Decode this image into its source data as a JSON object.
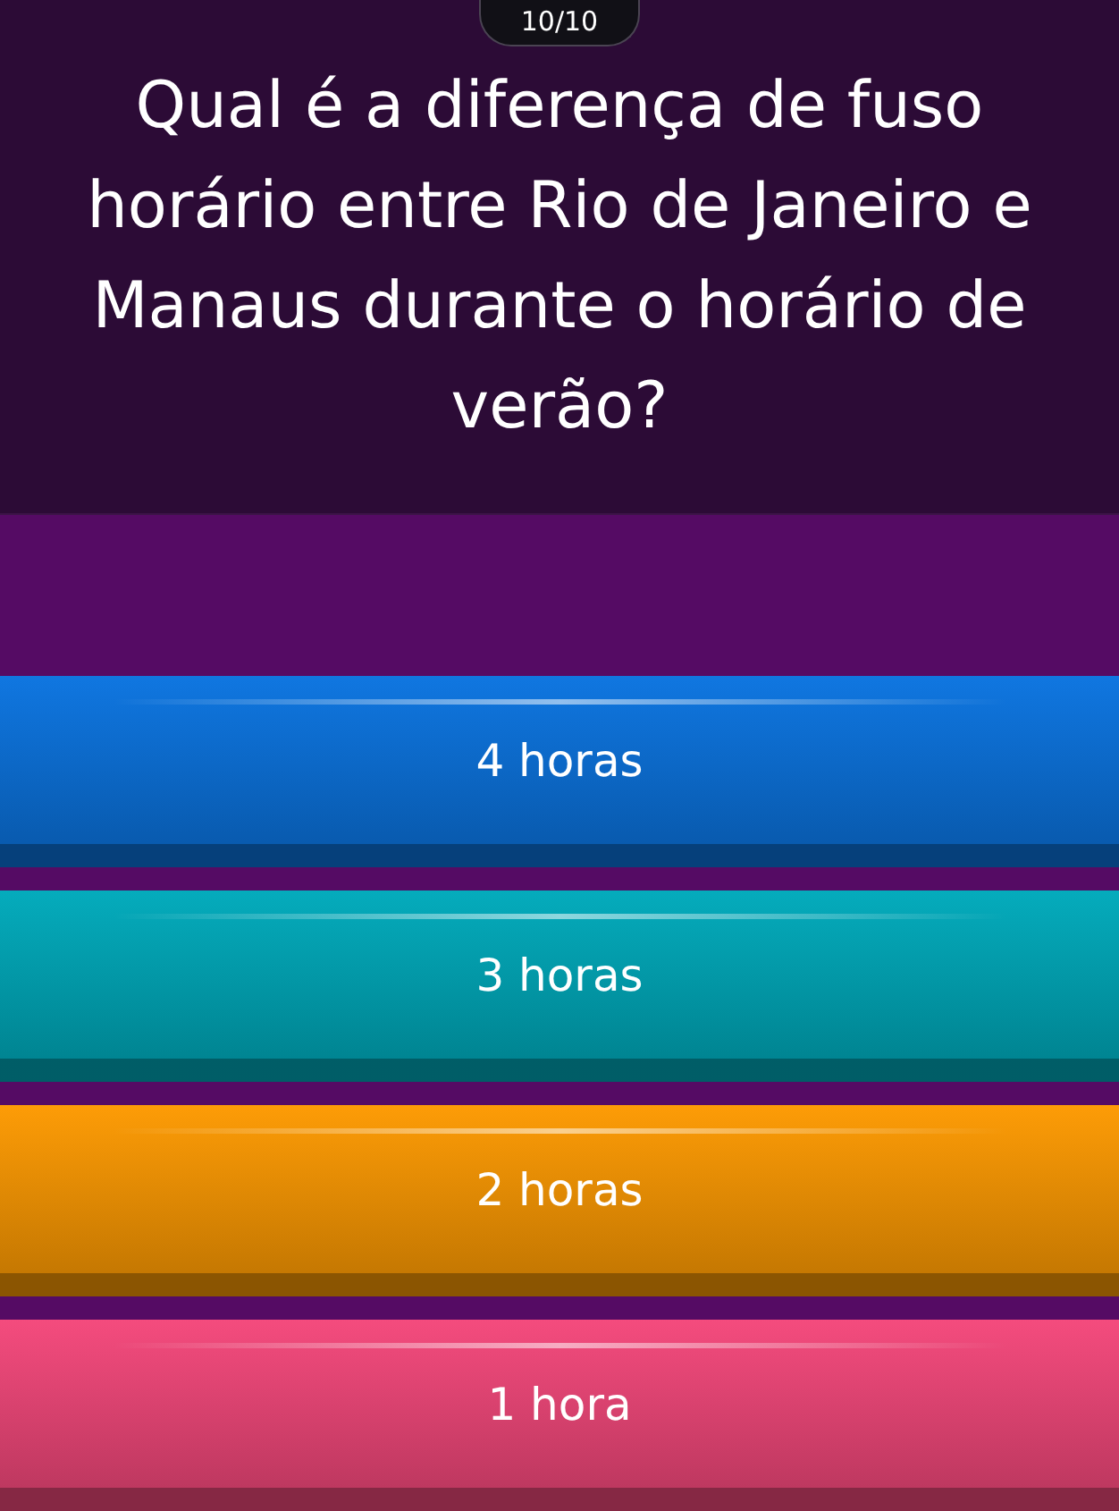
{
  "counter": "10/10",
  "question": "Qual é a diferença de fuso horário entre Rio de Janeiro e Manaus durante o horário de verão?",
  "options": [
    {
      "label": "4 horas",
      "color": "#0b74e0"
    },
    {
      "label": "3 horas",
      "color": "#00aabb"
    },
    {
      "label": "2 horas",
      "color": "#fd9a02"
    },
    {
      "label": "1 hora",
      "color": "#f4487b"
    }
  ]
}
